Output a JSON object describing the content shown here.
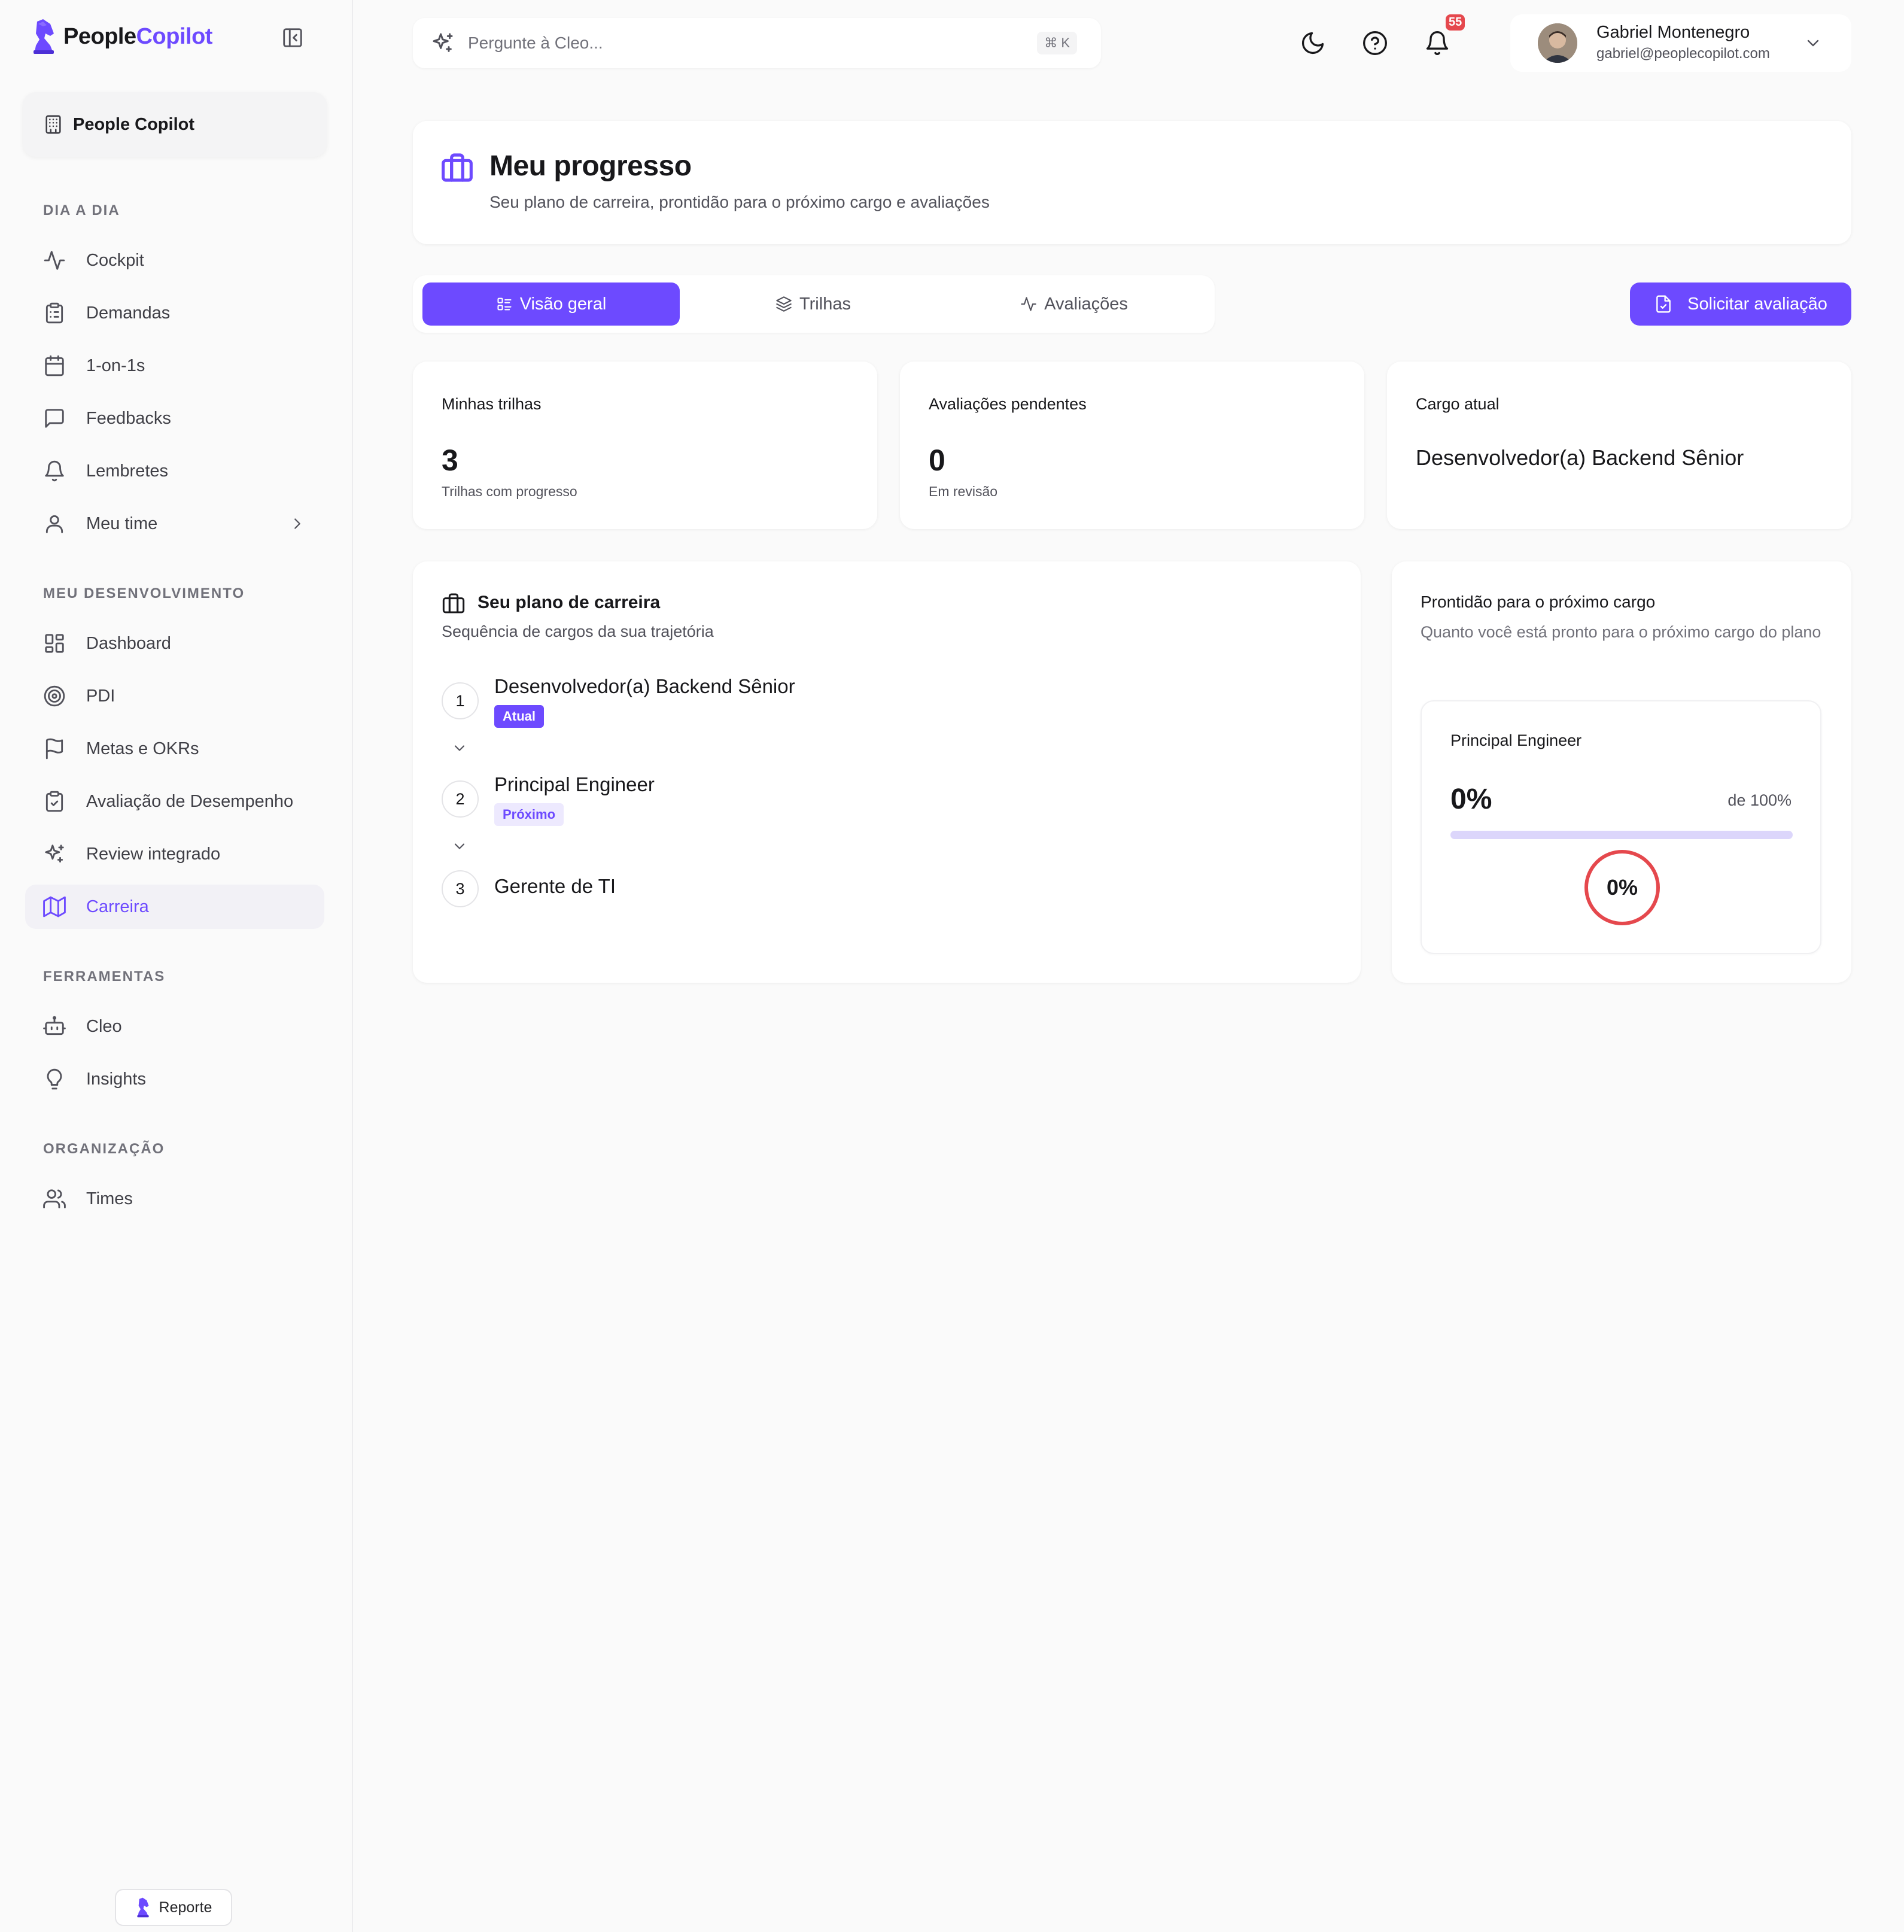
{
  "brand": {
    "name_part1": "People",
    "name_part2": "Copilot"
  },
  "org": {
    "name": "People Copilot"
  },
  "sidebar": {
    "sections": [
      {
        "label": "DIA A DIA",
        "items": [
          {
            "label": "Cockpit",
            "icon": "activity-icon"
          },
          {
            "label": "Demandas",
            "icon": "clipboard-list-icon"
          },
          {
            "label": "1-on-1s",
            "icon": "calendar-icon"
          },
          {
            "label": "Feedbacks",
            "icon": "message-square-icon"
          },
          {
            "label": "Lembretes",
            "icon": "bell-icon"
          },
          {
            "label": "Meu time",
            "icon": "user-icon",
            "has_chevron": true
          }
        ]
      },
      {
        "label": "MEU DESENVOLVIMENTO",
        "items": [
          {
            "label": "Dashboard",
            "icon": "layout-dashboard-icon"
          },
          {
            "label": "PDI",
            "icon": "target-icon"
          },
          {
            "label": "Metas e OKRs",
            "icon": "flag-icon"
          },
          {
            "label": "Avaliação de Desempenho",
            "icon": "clipboard-check-icon"
          },
          {
            "label": "Review integrado",
            "icon": "sparkles-icon"
          },
          {
            "label": "Carreira",
            "icon": "map-icon",
            "active": true
          }
        ]
      },
      {
        "label": "FERRAMENTAS",
        "items": [
          {
            "label": "Cleo",
            "icon": "bot-icon"
          },
          {
            "label": "Insights",
            "icon": "lightbulb-icon"
          }
        ]
      },
      {
        "label": "ORGANIZAÇÃO",
        "items": [
          {
            "label": "Times",
            "icon": "users-icon"
          }
        ]
      }
    ],
    "report_label": "Reporte"
  },
  "topbar": {
    "search_placeholder": "Pergunte à Cleo...",
    "search_shortcut": "⌘ K",
    "notification_count": "55",
    "user": {
      "name": "Gabriel Montenegro",
      "email": "gabriel@peoplecopilot.com"
    }
  },
  "header": {
    "title": "Meu progresso",
    "subtitle": "Seu plano de carreira, prontidão para o próximo cargo e avaliações"
  },
  "tabs": [
    {
      "label": "Visão geral",
      "icon": "list-icon",
      "active": true
    },
    {
      "label": "Trilhas",
      "icon": "layers-icon",
      "active": false
    },
    {
      "label": "Avaliações",
      "icon": "activity-icon",
      "active": false
    }
  ],
  "actions": {
    "request_review": "Solicitar avaliação"
  },
  "stats": {
    "tracks": {
      "label": "Minhas trilhas",
      "value": "3",
      "sub": "Trilhas com progresso"
    },
    "pending": {
      "label": "Avaliações pendentes",
      "value": "0",
      "sub": "Em revisão"
    },
    "role": {
      "label": "Cargo atual",
      "value": "Desenvolvedor(a) Backend Sênior"
    }
  },
  "career_plan": {
    "title": "Seu plano de carreira",
    "subtitle": "Sequência de cargos da sua trajetória",
    "steps": [
      {
        "number": "1",
        "title": "Desenvolvedor(a) Backend Sênior",
        "tag": "Atual"
      },
      {
        "number": "2",
        "title": "Principal Engineer",
        "tag": "Próximo"
      },
      {
        "number": "3",
        "title": "Gerente de TI",
        "tag": ""
      }
    ]
  },
  "readiness": {
    "title": "Prontidão para o próximo cargo",
    "subtitle": "Quanto você está pronto para o próximo cargo do plano",
    "role": "Principal Engineer",
    "percent_label": "0%",
    "of_label": "de 100%",
    "progress_fraction": 0,
    "ring_label": "0%",
    "ring_color": "#e5484d"
  },
  "colors": {
    "accent": "#6d4aff",
    "badge": "#e5484d"
  }
}
